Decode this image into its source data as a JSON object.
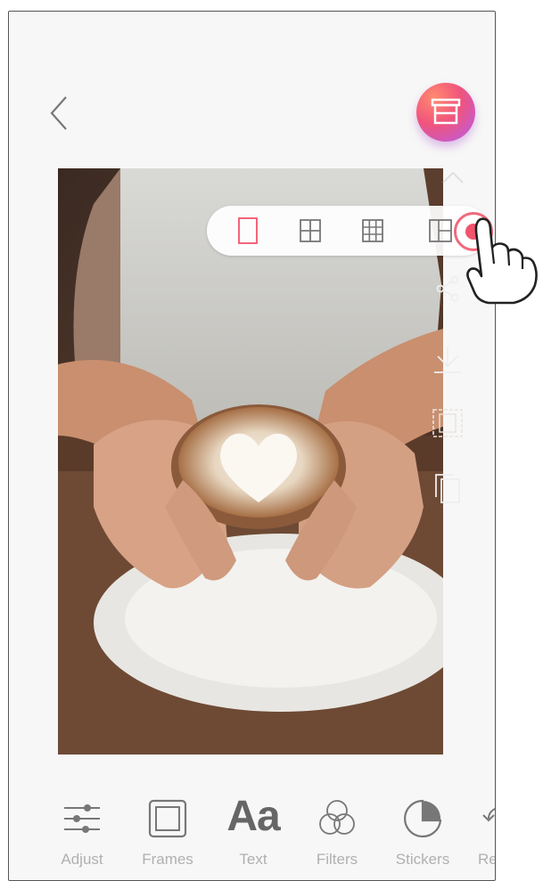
{
  "toolbar": {
    "tools": [
      {
        "label": "Adjust",
        "icon": "adjust-sliders-icon"
      },
      {
        "label": "Frames",
        "icon": "frame-icon"
      },
      {
        "label": "Text",
        "icon": "text-icon",
        "glyph": "Aa"
      },
      {
        "label": "Filters",
        "icon": "filters-icon"
      },
      {
        "label": "Stickers",
        "icon": "sticker-icon"
      },
      {
        "label": "Re",
        "icon": "rotate-icon"
      }
    ]
  },
  "layout_bar": {
    "options": [
      "single-layout-icon",
      "grid-2x2-icon",
      "grid-3x3-icon",
      "collage-layout-icon"
    ],
    "selected_index": 0
  },
  "colors": {
    "accent": "#f2546c",
    "print_gradient_start": "#ff8a6f",
    "print_gradient_end": "#b45cf0"
  }
}
